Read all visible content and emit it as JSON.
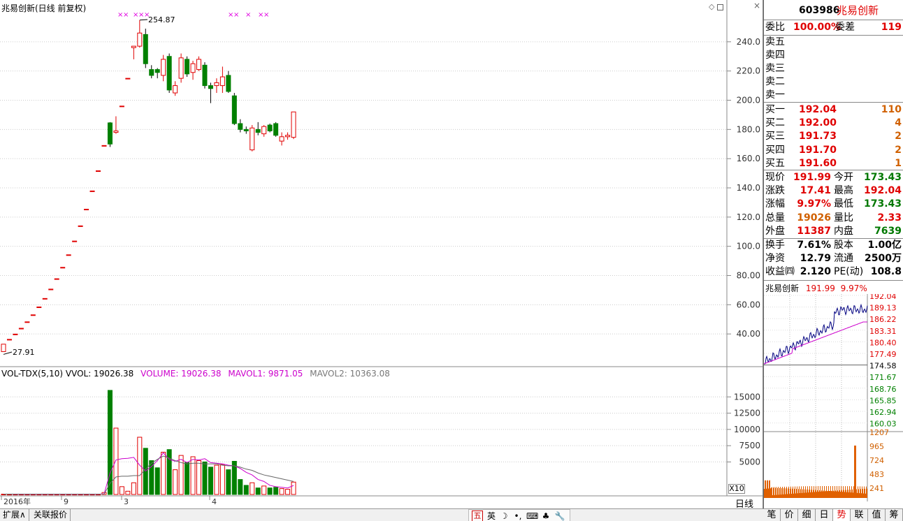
{
  "chart": {
    "title": "兆易创新(日线 前复权)",
    "marker_high": "254.87",
    "marker_low": "27.91",
    "yticks": [
      "240.0",
      "220.0",
      "200.0",
      "180.0",
      "160.0",
      "140.0",
      "120.0",
      "100.0",
      "80.00",
      "60.00",
      "40.00"
    ],
    "ytick_values": [
      240,
      220,
      200,
      180,
      160,
      140,
      120,
      100,
      80,
      60,
      40
    ],
    "xlabels": [
      "2016年",
      "9",
      "3",
      "4"
    ],
    "vol_header": {
      "name": "VOL-TDX(5,10)",
      "vvol": "VVOL: 19026.38",
      "volume": "VOLUME: 19026.38",
      "mavol1": "MAVOL1: 9871.05",
      "mavol2": "MAVOL2: 10363.08"
    },
    "vol_yticks": [
      "15000",
      "12500",
      "10000",
      "7500",
      "5000"
    ],
    "vol_ytick_values": [
      15000,
      12500,
      10000,
      7500,
      5000
    ],
    "vol_unit": "X10",
    "period_label": "日线",
    "icons": [
      "diamond-icon",
      "square-icon",
      "close-icon"
    ]
  },
  "chart_data": {
    "type": "candlestick",
    "candles": [
      {
        "o": 27.9,
        "c": 33,
        "h": 33,
        "l": 27.9,
        "v": 50
      },
      {
        "o": 36.3,
        "c": 36.3,
        "h": 36.3,
        "l": 36.3,
        "v": 40
      },
      {
        "o": 39.9,
        "c": 39.9,
        "h": 39.9,
        "l": 39.9,
        "v": 40
      },
      {
        "o": 43.9,
        "c": 43.9,
        "h": 43.9,
        "l": 43.9,
        "v": 40
      },
      {
        "o": 48.3,
        "c": 48.3,
        "h": 48.3,
        "l": 48.3,
        "v": 40
      },
      {
        "o": 53.1,
        "c": 53.1,
        "h": 53.1,
        "l": 53.1,
        "v": 40
      },
      {
        "o": 58.5,
        "c": 58.5,
        "h": 58.5,
        "l": 58.5,
        "v": 40
      },
      {
        "o": 64.3,
        "c": 64.3,
        "h": 64.3,
        "l": 64.3,
        "v": 40
      },
      {
        "o": 70.7,
        "c": 70.7,
        "h": 70.7,
        "l": 70.7,
        "v": 40
      },
      {
        "o": 77.8,
        "c": 77.8,
        "h": 77.8,
        "l": 77.8,
        "v": 40
      },
      {
        "o": 85.6,
        "c": 85.6,
        "h": 85.6,
        "l": 85.6,
        "v": 40
      },
      {
        "o": 94.2,
        "c": 94.2,
        "h": 94.2,
        "l": 94.2,
        "v": 40
      },
      {
        "o": 103.6,
        "c": 103.6,
        "h": 103.6,
        "l": 103.6,
        "v": 40
      },
      {
        "o": 114,
        "c": 114,
        "h": 114,
        "l": 114,
        "v": 40
      },
      {
        "o": 125.4,
        "c": 125.4,
        "h": 125.4,
        "l": 125.4,
        "v": 40
      },
      {
        "o": 137.9,
        "c": 137.9,
        "h": 137.9,
        "l": 137.9,
        "v": 40
      },
      {
        "o": 151.7,
        "c": 151.7,
        "h": 151.7,
        "l": 151.7,
        "v": 40
      },
      {
        "o": 169,
        "c": 169,
        "h": 169,
        "l": 169,
        "v": 300
      },
      {
        "o": 184.5,
        "c": 170,
        "h": 185,
        "l": 168,
        "v": 16000
      },
      {
        "o": 178,
        "c": 179,
        "h": 189,
        "l": 177,
        "v": 10200
      },
      {
        "o": 196,
        "c": 196,
        "h": 196,
        "l": 196,
        "v": 1200
      },
      {
        "o": 215,
        "c": 215,
        "h": 215,
        "l": 215,
        "v": 500
      },
      {
        "o": 236,
        "c": 237,
        "h": 237,
        "l": 228,
        "v": 1800
      },
      {
        "o": 237,
        "c": 246,
        "h": 254.87,
        "l": 236,
        "v": 8800
      },
      {
        "o": 245,
        "c": 225,
        "h": 249,
        "l": 222,
        "v": 7100
      },
      {
        "o": 221,
        "c": 217,
        "h": 224,
        "l": 215,
        "v": 5200
      },
      {
        "o": 221,
        "c": 219,
        "h": 222,
        "l": 215,
        "v": 4100
      },
      {
        "o": 217,
        "c": 228,
        "h": 231,
        "l": 213,
        "v": 6500
      },
      {
        "o": 230,
        "c": 207,
        "h": 232,
        "l": 205,
        "v": 6900
      },
      {
        "o": 205,
        "c": 210,
        "h": 213,
        "l": 203,
        "v": 3800
      },
      {
        "o": 215,
        "c": 229,
        "h": 232,
        "l": 212,
        "v": 6000
      },
      {
        "o": 228,
        "c": 218,
        "h": 230,
        "l": 216,
        "v": 4900
      },
      {
        "o": 219,
        "c": 225,
        "h": 227,
        "l": 214,
        "v": 5800
      },
      {
        "o": 221,
        "c": 228,
        "h": 230,
        "l": 220,
        "v": 5200
      },
      {
        "o": 224,
        "c": 210,
        "h": 226,
        "l": 208,
        "v": 5000
      },
      {
        "o": 210,
        "c": 208,
        "h": 212,
        "l": 198,
        "v": 4200
      },
      {
        "o": 210,
        "c": 212,
        "h": 215,
        "l": 205,
        "v": 4500
      },
      {
        "o": 210,
        "c": 216,
        "h": 223,
        "l": 205,
        "v": 4600
      },
      {
        "o": 217,
        "c": 206,
        "h": 220,
        "l": 205,
        "v": 3800
      },
      {
        "o": 203,
        "c": 184,
        "h": 205,
        "l": 183,
        "v": 5100
      },
      {
        "o": 184,
        "c": 180,
        "h": 187,
        "l": 178,
        "v": 2300
      },
      {
        "o": 180,
        "c": 179,
        "h": 182,
        "l": 177,
        "v": 1400
      },
      {
        "o": 166,
        "c": 181,
        "h": 183,
        "l": 165,
        "v": 1800
      },
      {
        "o": 180,
        "c": 178,
        "h": 185,
        "l": 176,
        "v": 1000
      },
      {
        "o": 177,
        "c": 182,
        "h": 183,
        "l": 175,
        "v": 1300
      },
      {
        "o": 183,
        "c": 179,
        "h": 184,
        "l": 178,
        "v": 1000
      },
      {
        "o": 184,
        "c": 176,
        "h": 185,
        "l": 175,
        "v": 1100
      },
      {
        "o": 172,
        "c": 175,
        "h": 178,
        "l": 169,
        "v": 900
      },
      {
        "o": 175,
        "c": 176,
        "h": 178,
        "l": 173,
        "v": 800
      },
      {
        "o": 174.6,
        "c": 192,
        "h": 192.04,
        "l": 173.4,
        "v": 1902
      }
    ],
    "mavol1": [
      50,
      48,
      46,
      44,
      42,
      40,
      40,
      40,
      40,
      40,
      40,
      40,
      40,
      40,
      40,
      40,
      40,
      90,
      3300,
      5300,
      5500,
      5560,
      5700,
      4500,
      3600,
      4300,
      5200,
      6400,
      5400,
      5100,
      5400,
      4900,
      5400,
      5300,
      5500,
      4900,
      4800,
      4700,
      4500,
      4400,
      4000,
      3400,
      3000,
      2300,
      2000,
      1400,
      1200,
      1100,
      1000,
      1380
    ],
    "mavol2": [
      50,
      48,
      46,
      44,
      42,
      40,
      40,
      40,
      40,
      40,
      40,
      40,
      40,
      40,
      40,
      40,
      40,
      60,
      1700,
      2700,
      2800,
      2800,
      2900,
      2900,
      3900,
      4800,
      5400,
      5900,
      5600,
      5200,
      4900,
      4700,
      4800,
      4800,
      4700,
      4700,
      4700,
      4500,
      4400,
      4400,
      4200,
      3900,
      3700,
      3300,
      3000,
      2800,
      2600,
      2400,
      2200,
      2000
    ],
    "ylim": [
      20,
      260
    ],
    "vol_ylim": [
      0,
      17500
    ]
  },
  "quote": {
    "code": "603986",
    "name": "兆易创新",
    "weibi_label": "委比",
    "weibi_value": "100.00%",
    "weicha_label": "委差",
    "weicha_value": "119",
    "asks": [
      {
        "label": "卖五",
        "price": "",
        "vol": ""
      },
      {
        "label": "卖四",
        "price": "",
        "vol": ""
      },
      {
        "label": "卖三",
        "price": "",
        "vol": ""
      },
      {
        "label": "卖二",
        "price": "",
        "vol": ""
      },
      {
        "label": "卖一",
        "price": "",
        "vol": ""
      }
    ],
    "bids": [
      {
        "label": "买一",
        "price": "192.04",
        "vol": "110"
      },
      {
        "label": "买二",
        "price": "192.00",
        "vol": "4"
      },
      {
        "label": "买三",
        "price": "191.73",
        "vol": "2"
      },
      {
        "label": "买四",
        "price": "191.70",
        "vol": "2"
      },
      {
        "label": "买五",
        "price": "191.60",
        "vol": "1"
      }
    ],
    "stats": [
      {
        "l1": "现价",
        "v1": "191.99",
        "c1": "red",
        "l2": "今开",
        "v2": "173.43",
        "c2": "green"
      },
      {
        "l1": "涨跌",
        "v1": "17.41",
        "c1": "red",
        "l2": "最高",
        "v2": "192.04",
        "c2": "red"
      },
      {
        "l1": "涨幅",
        "v1": "9.97%",
        "c1": "red",
        "l2": "最低",
        "v2": "173.43",
        "c2": "green"
      },
      {
        "l1": "总量",
        "v1": "19026",
        "c1": "orange",
        "l2": "量比",
        "v2": "2.33",
        "c2": "red"
      },
      {
        "l1": "外盘",
        "v1": "11387",
        "c1": "red",
        "l2": "内盘",
        "v2": "7639",
        "c2": "green"
      }
    ],
    "stats2": [
      {
        "l1": "换手",
        "v1": "7.61%",
        "l2": "股本",
        "v2": "1.00亿"
      },
      {
        "l1": "净资",
        "v1": "12.79",
        "l2": "流通",
        "v2": "2500万"
      },
      {
        "l1": "收益㈣",
        "v1": "2.120",
        "l2": "PE(动)",
        "v2": "108.8"
      }
    ]
  },
  "mini": {
    "name": "兆易创新",
    "price": "191.99",
    "pct": "9.97%",
    "price_ticks": [
      "192.04",
      "189.13",
      "186.22",
      "183.31",
      "180.40",
      "177.49",
      "174.58",
      "171.67",
      "168.76",
      "165.85",
      "162.94",
      "160.03"
    ],
    "vol_ticks": [
      "1207",
      "965",
      "724",
      "483",
      "241"
    ]
  },
  "bottom_tabs": [
    "扩展∧",
    "关联报价"
  ],
  "right_tabs": [
    "笔",
    "价",
    "细",
    "日",
    "势",
    "联",
    "值",
    "筹"
  ],
  "ime": [
    "五",
    "英",
    "☽",
    "•,",
    "⌨",
    "♣",
    "🔧"
  ]
}
